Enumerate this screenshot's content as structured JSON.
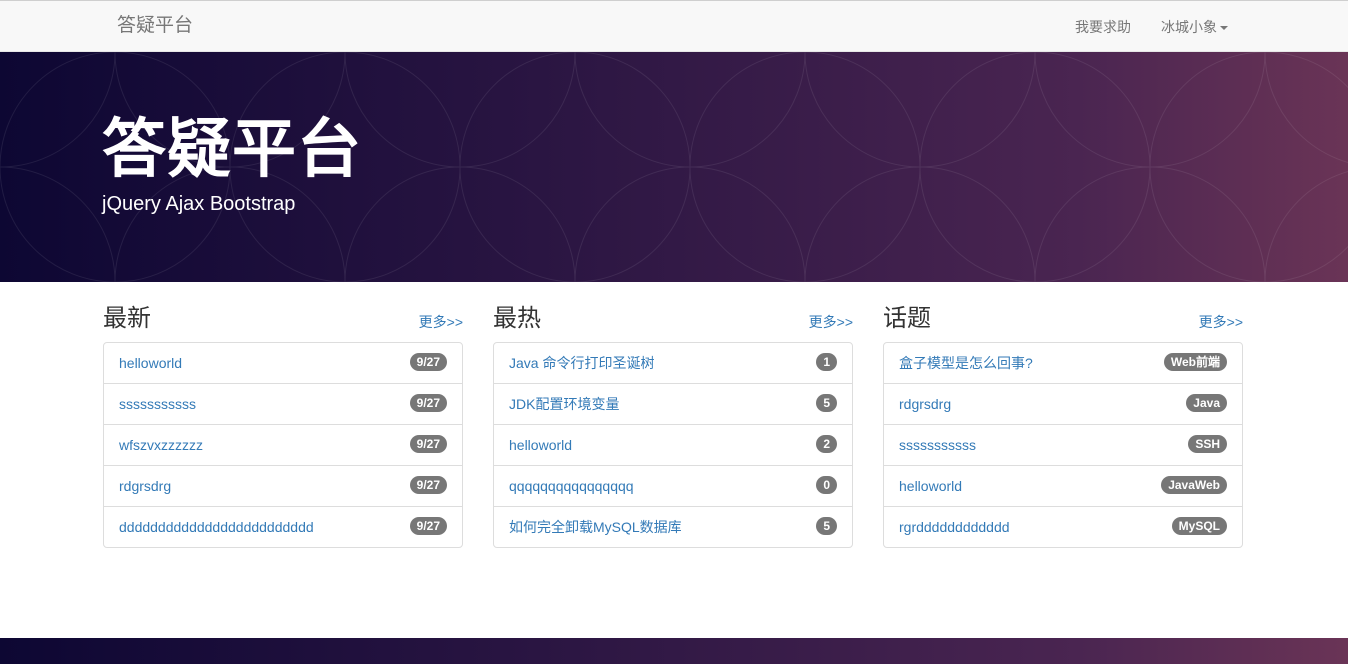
{
  "navbar": {
    "brand": "答疑平台",
    "help_link": "我要求助",
    "user_menu": "冰城小象"
  },
  "hero": {
    "title": "答疑平台",
    "subtitle": "jQuery Ajax Bootstrap"
  },
  "columns": [
    {
      "title": "最新",
      "more": "更多>>",
      "items": [
        {
          "text": "helloworld",
          "badge": "9/27"
        },
        {
          "text": "sssssssssss",
          "badge": "9/27"
        },
        {
          "text": "wfszvxzzzzzz",
          "badge": "9/27"
        },
        {
          "text": "rdgrsdrg",
          "badge": "9/27"
        },
        {
          "text": "ddddddddddddddddddddddddd",
          "badge": "9/27"
        }
      ]
    },
    {
      "title": "最热",
      "more": "更多>>",
      "items": [
        {
          "text": "Java 命令行打印圣诞树",
          "badge": "1"
        },
        {
          "text": "JDK配置环境变量",
          "badge": "5"
        },
        {
          "text": "helloworld",
          "badge": "2"
        },
        {
          "text": "qqqqqqqqqqqqqqqq",
          "badge": "0"
        },
        {
          "text": "如何完全卸载MySQL数据库",
          "badge": "5"
        }
      ]
    },
    {
      "title": "话题",
      "more": "更多>>",
      "items": [
        {
          "text": "盒子模型是怎么回事?",
          "badge": "Web前端"
        },
        {
          "text": "rdgrsdrg",
          "badge": "Java"
        },
        {
          "text": "sssssssssss",
          "badge": "SSH"
        },
        {
          "text": "helloworld",
          "badge": "JavaWeb"
        },
        {
          "text": "rgrdddddddddddd",
          "badge": "MySQL"
        }
      ]
    }
  ],
  "colors": {
    "link": "#337ab7",
    "badge": "#777777",
    "hero_start": "#0d0733",
    "hero_end": "#6a3456"
  }
}
